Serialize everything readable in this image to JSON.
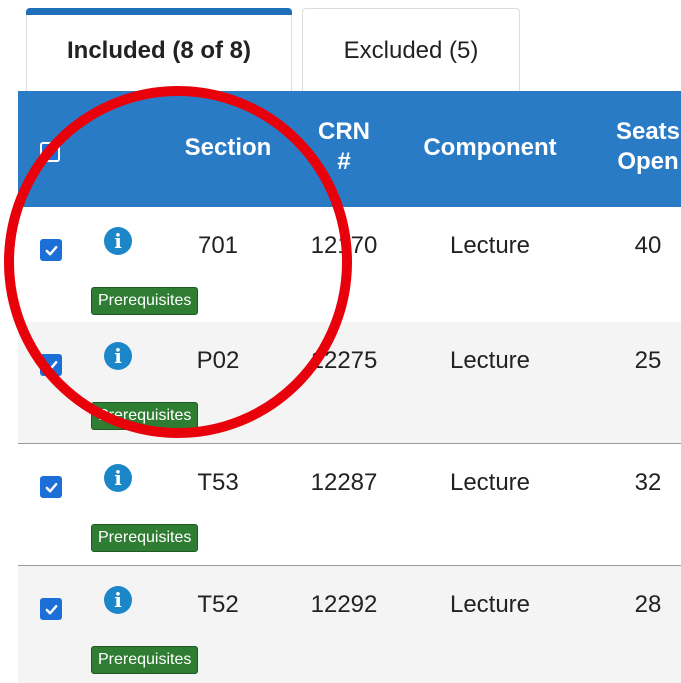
{
  "tabs": {
    "included": "Included (8 of 8)",
    "excluded": "Excluded (5)"
  },
  "table": {
    "headers": {
      "section": "Section",
      "crn_line1": "CRN",
      "crn_line2": "#",
      "component": "Component",
      "seats_line1": "Seats",
      "seats_line2": "Open"
    },
    "rows": [
      {
        "section": "701",
        "crn": "12170",
        "component": "Lecture",
        "seats_open": "40",
        "badge": "Prerequisites",
        "checked": true
      },
      {
        "section": "P02",
        "crn": "12275",
        "component": "Lecture",
        "seats_open": "25",
        "badge": "Prerequisites",
        "checked": true
      },
      {
        "section": "T53",
        "crn": "12287",
        "component": "Lecture",
        "seats_open": "32",
        "badge": "Prerequisites",
        "checked": true
      },
      {
        "section": "T52",
        "crn": "12292",
        "component": "Lecture",
        "seats_open": "28",
        "badge": "Prerequisites",
        "checked": true
      }
    ]
  },
  "icons": {
    "checkbox": "checkmark-icon",
    "info": "info-icon"
  },
  "colors": {
    "header_bg": "#2a7bc6",
    "tab_accent": "#1f6fba",
    "badge_bg": "#2f7d32",
    "info_icon": "#1b86c8",
    "annotation_circle": "#e8000b"
  }
}
